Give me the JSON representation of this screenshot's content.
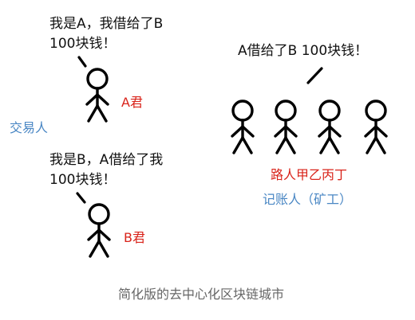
{
  "colors": {
    "name_red": "#d9241b",
    "role_blue": "#4a87c4",
    "caption_gray": "#666666",
    "stroke": "#000000"
  },
  "person_a": {
    "speech_line1": "我是A，我借给了B",
    "speech_line2": "100块钱！",
    "name": "A君"
  },
  "person_b": {
    "speech_line1": "我是B，A借给了我",
    "speech_line2": "100块钱！",
    "name": "B君"
  },
  "left_role_label": "交易人",
  "recorders": {
    "speech": "A借给了B 100块钱！",
    "names": "路人甲乙丙丁",
    "role_label": "记账人（矿工）",
    "count": 4
  },
  "caption": "简化版的去中心化区块链城市",
  "icons": [
    "stick-figure-icon",
    "speech-mark-icon"
  ]
}
